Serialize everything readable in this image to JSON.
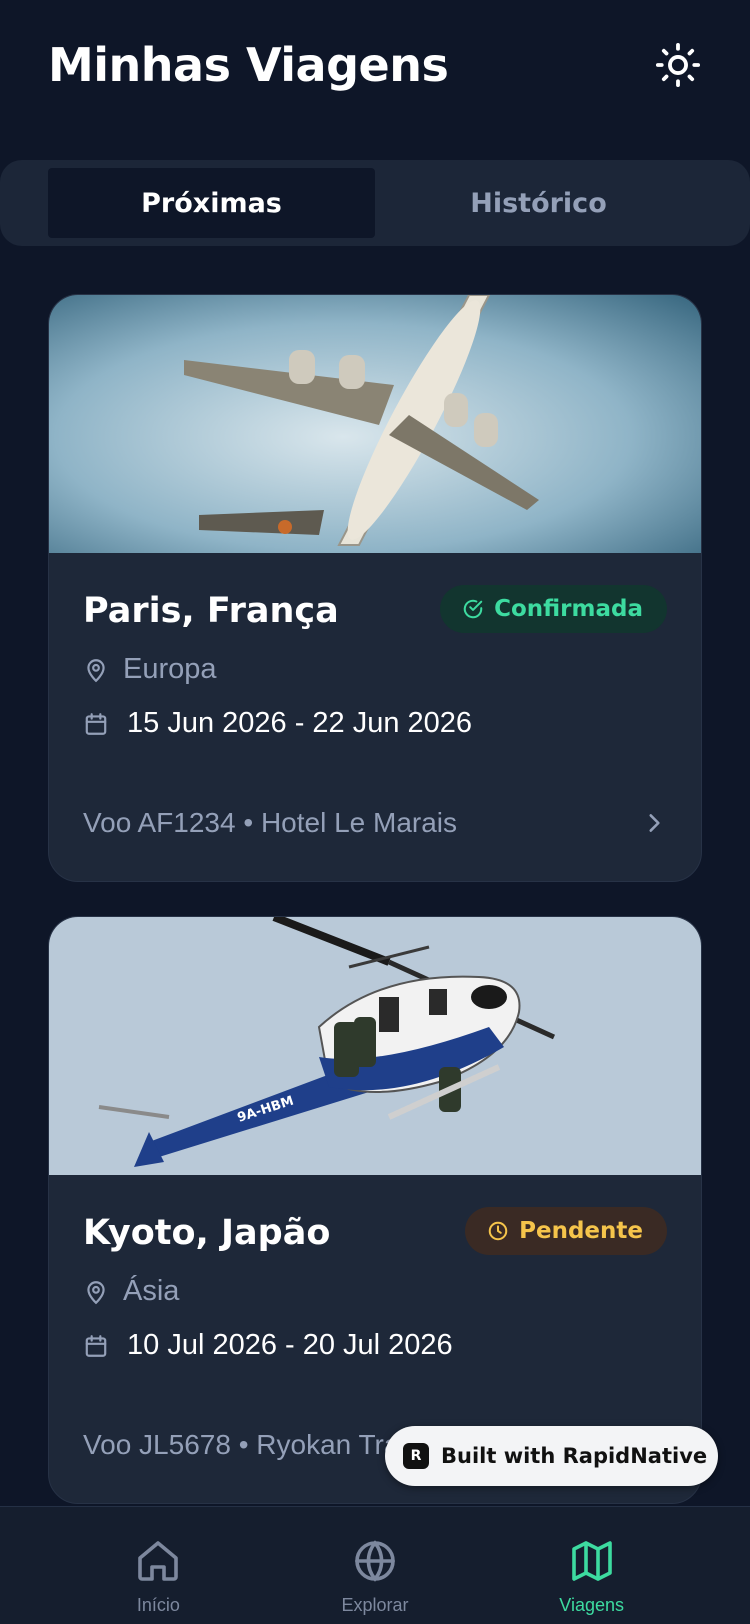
{
  "header": {
    "title": "Minhas Viagens",
    "theme_icon": "sun-icon"
  },
  "tabs": [
    {
      "label": "Próximas",
      "active": true
    },
    {
      "label": "Histórico",
      "active": false
    }
  ],
  "trips": [
    {
      "destination": "Paris, França",
      "status": "Confirmada",
      "status_icon": "check-circle-icon",
      "status_color": "#3ddba0",
      "region": "Europa",
      "dates": "15 Jun 2026 - 22 Jun 2026",
      "details": "Voo AF1234 • Hotel Le Marais",
      "image": "airplane-photo"
    },
    {
      "destination": "Kyoto, Japão",
      "status": "Pendente",
      "status_icon": "clock-icon",
      "status_color": "#f5c44b",
      "region": "Ásia",
      "dates": "10 Jul 2026 - 20 Jul 2026",
      "details": "Voo JL5678 • Ryokan Tra",
      "image": "helicopter-photo"
    }
  ],
  "watermark": {
    "label": "Built with RapidNative"
  },
  "tabbar": {
    "items": [
      {
        "icon": "home-icon",
        "label": "Início",
        "active": false
      },
      {
        "icon": "globe-icon",
        "label": "Explorar",
        "active": false
      },
      {
        "icon": "map-icon",
        "label": "Viagens",
        "active": true
      }
    ]
  },
  "colors": {
    "background": "#0e1628",
    "card": "#1e2839",
    "accent": "#3ddba0",
    "pending": "#f5c44b"
  }
}
